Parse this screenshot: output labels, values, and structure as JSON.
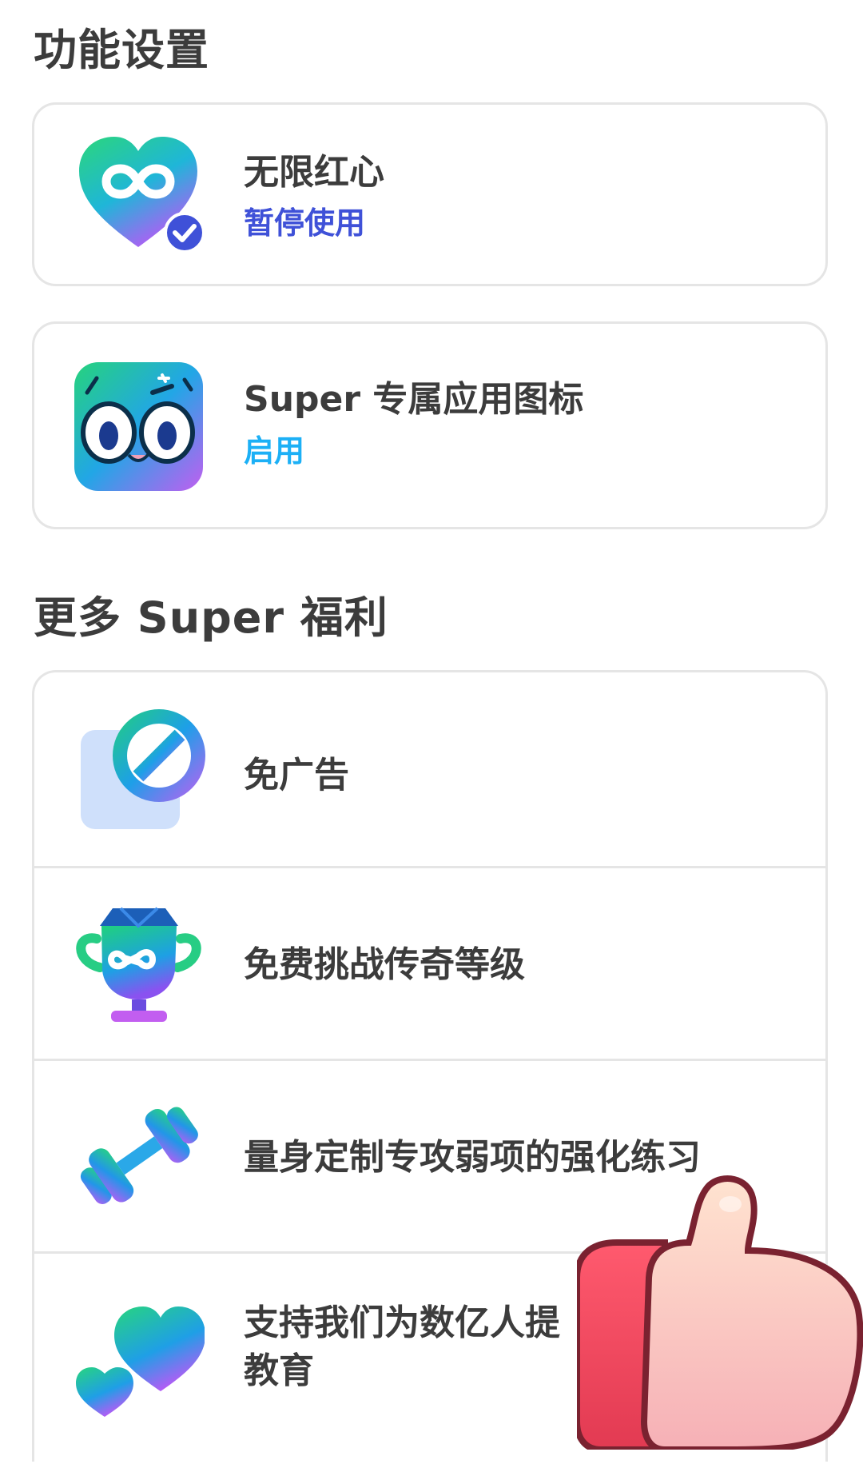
{
  "sections": {
    "feature_settings_title": "功能设置",
    "more_benefits_title": "更多 Super 福利"
  },
  "feature_settings": {
    "unlimited_hearts": {
      "label": "无限红心",
      "action": "暂停使用",
      "icon": "infinity-heart-icon"
    },
    "app_icon": {
      "label": "Super 专属应用图标",
      "action": "启用",
      "icon": "super-owl-app-icon"
    }
  },
  "benefits": [
    {
      "label": "免广告",
      "icon": "no-ads-icon"
    },
    {
      "label": "免费挑战传奇等级",
      "icon": "legendary-trophy-icon"
    },
    {
      "label": "量身定制专攻弱项的强化练习",
      "icon": "dumbbell-icon"
    },
    {
      "label_line1": "支持我们为数亿人提",
      "label_line2": "教育",
      "icon": "hearts-icon"
    }
  ],
  "overlay": {
    "icon": "thumbs-up-icon"
  },
  "colors": {
    "accent_blue": "#1cb0f6",
    "action_indigo": "#3f51d8",
    "text_dark": "#3c3c3c",
    "border": "#e5e5e5"
  }
}
